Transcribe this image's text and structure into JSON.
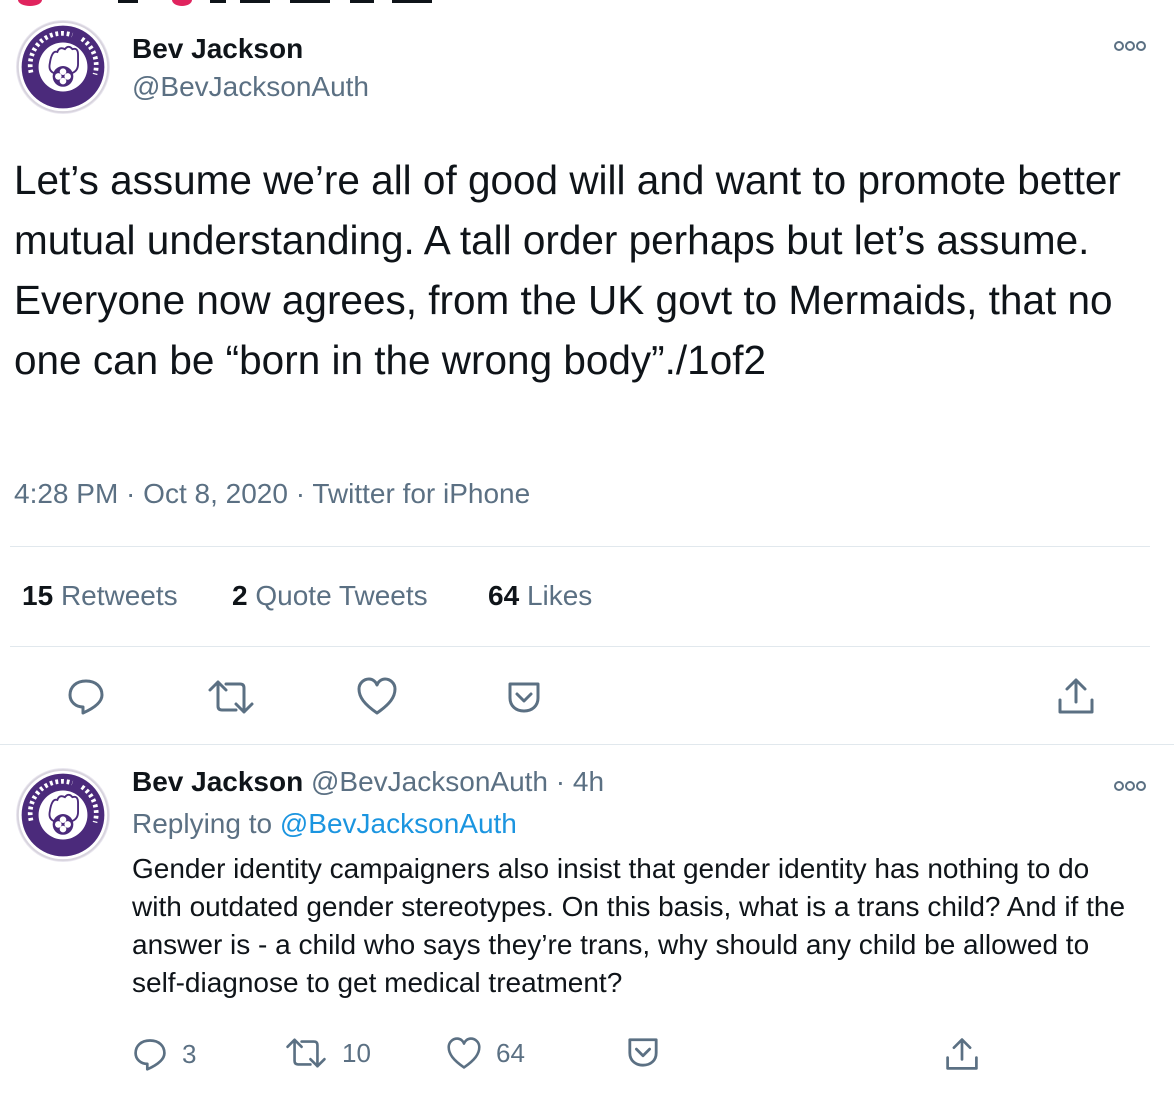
{
  "main_tweet": {
    "author": {
      "name": "Bev Jackson",
      "handle": "@BevJacksonAuth",
      "avatar_text": "GAY LIBERATION FRONT"
    },
    "text": "Let’s assume we’re all of good will and want to promote better mutual understanding. A tall order perhaps but let’s assume. Everyone now agrees, from the UK govt to Mermaids, that no one can be “born in the wrong body”./1of2",
    "time": "4:28 PM",
    "sep1": " · ",
    "date": "Oct 8, 2020",
    "sep2": " · ",
    "source": "Twitter for iPhone",
    "stats": {
      "retweets_count": "15",
      "retweets_label": "Retweets",
      "quotes_count": "2",
      "quotes_label": "Quote Tweets",
      "likes_count": "64",
      "likes_label": "Likes"
    },
    "icons": [
      "reply-icon",
      "retweet-icon",
      "like-icon",
      "bookmark-icon",
      "share-icon"
    ]
  },
  "reply_tweet": {
    "author": {
      "name": "Bev Jackson",
      "handle": "@BevJacksonAuth",
      "avatar_text": "GAY LIBERATION FRONT"
    },
    "sep": "·",
    "time": "4h",
    "replying_label": "Replying to",
    "replying_handle": "@BevJacksonAuth",
    "text": "Gender identity campaigners also insist that gender identity has nothing to do with outdated gender stereotypes. On this basis, what is a trans child? And if the answer is - a child who says they’re trans, why should any child be allowed to self-diagnose to get medical treatment?",
    "counts": {
      "replies": "3",
      "retweets": "10",
      "likes": "64"
    }
  },
  "colors": {
    "text": "#0f1419",
    "secondary": "#5b7083",
    "link": "#1b95e0",
    "divider": "#e1e8ed",
    "avatar_ring": "#4b2a7b"
  }
}
